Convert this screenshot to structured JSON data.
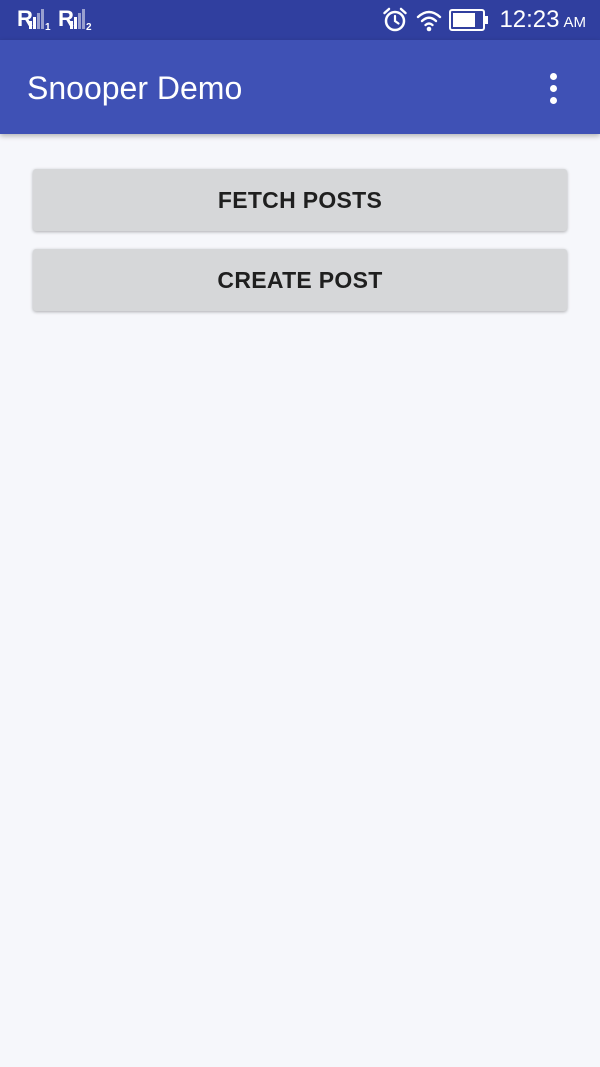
{
  "status_bar": {
    "sim1": {
      "letter": "R",
      "slot": "1"
    },
    "sim2": {
      "letter": "R",
      "slot": "2"
    },
    "icons": [
      "signal-icon",
      "alarm-icon",
      "wifi-icon",
      "battery-icon"
    ],
    "time": "12:23",
    "ampm": "AM"
  },
  "app_bar": {
    "title": "Snooper Demo",
    "menu_icon": "more-vert-icon"
  },
  "main": {
    "buttons": [
      {
        "label": "FETCH POSTS"
      },
      {
        "label": "CREATE POST"
      }
    ]
  },
  "colors": {
    "status_bar": "#303f9f",
    "app_bar": "#3f51b5",
    "background": "#f6f7fb",
    "button": "#d6d7d9"
  }
}
